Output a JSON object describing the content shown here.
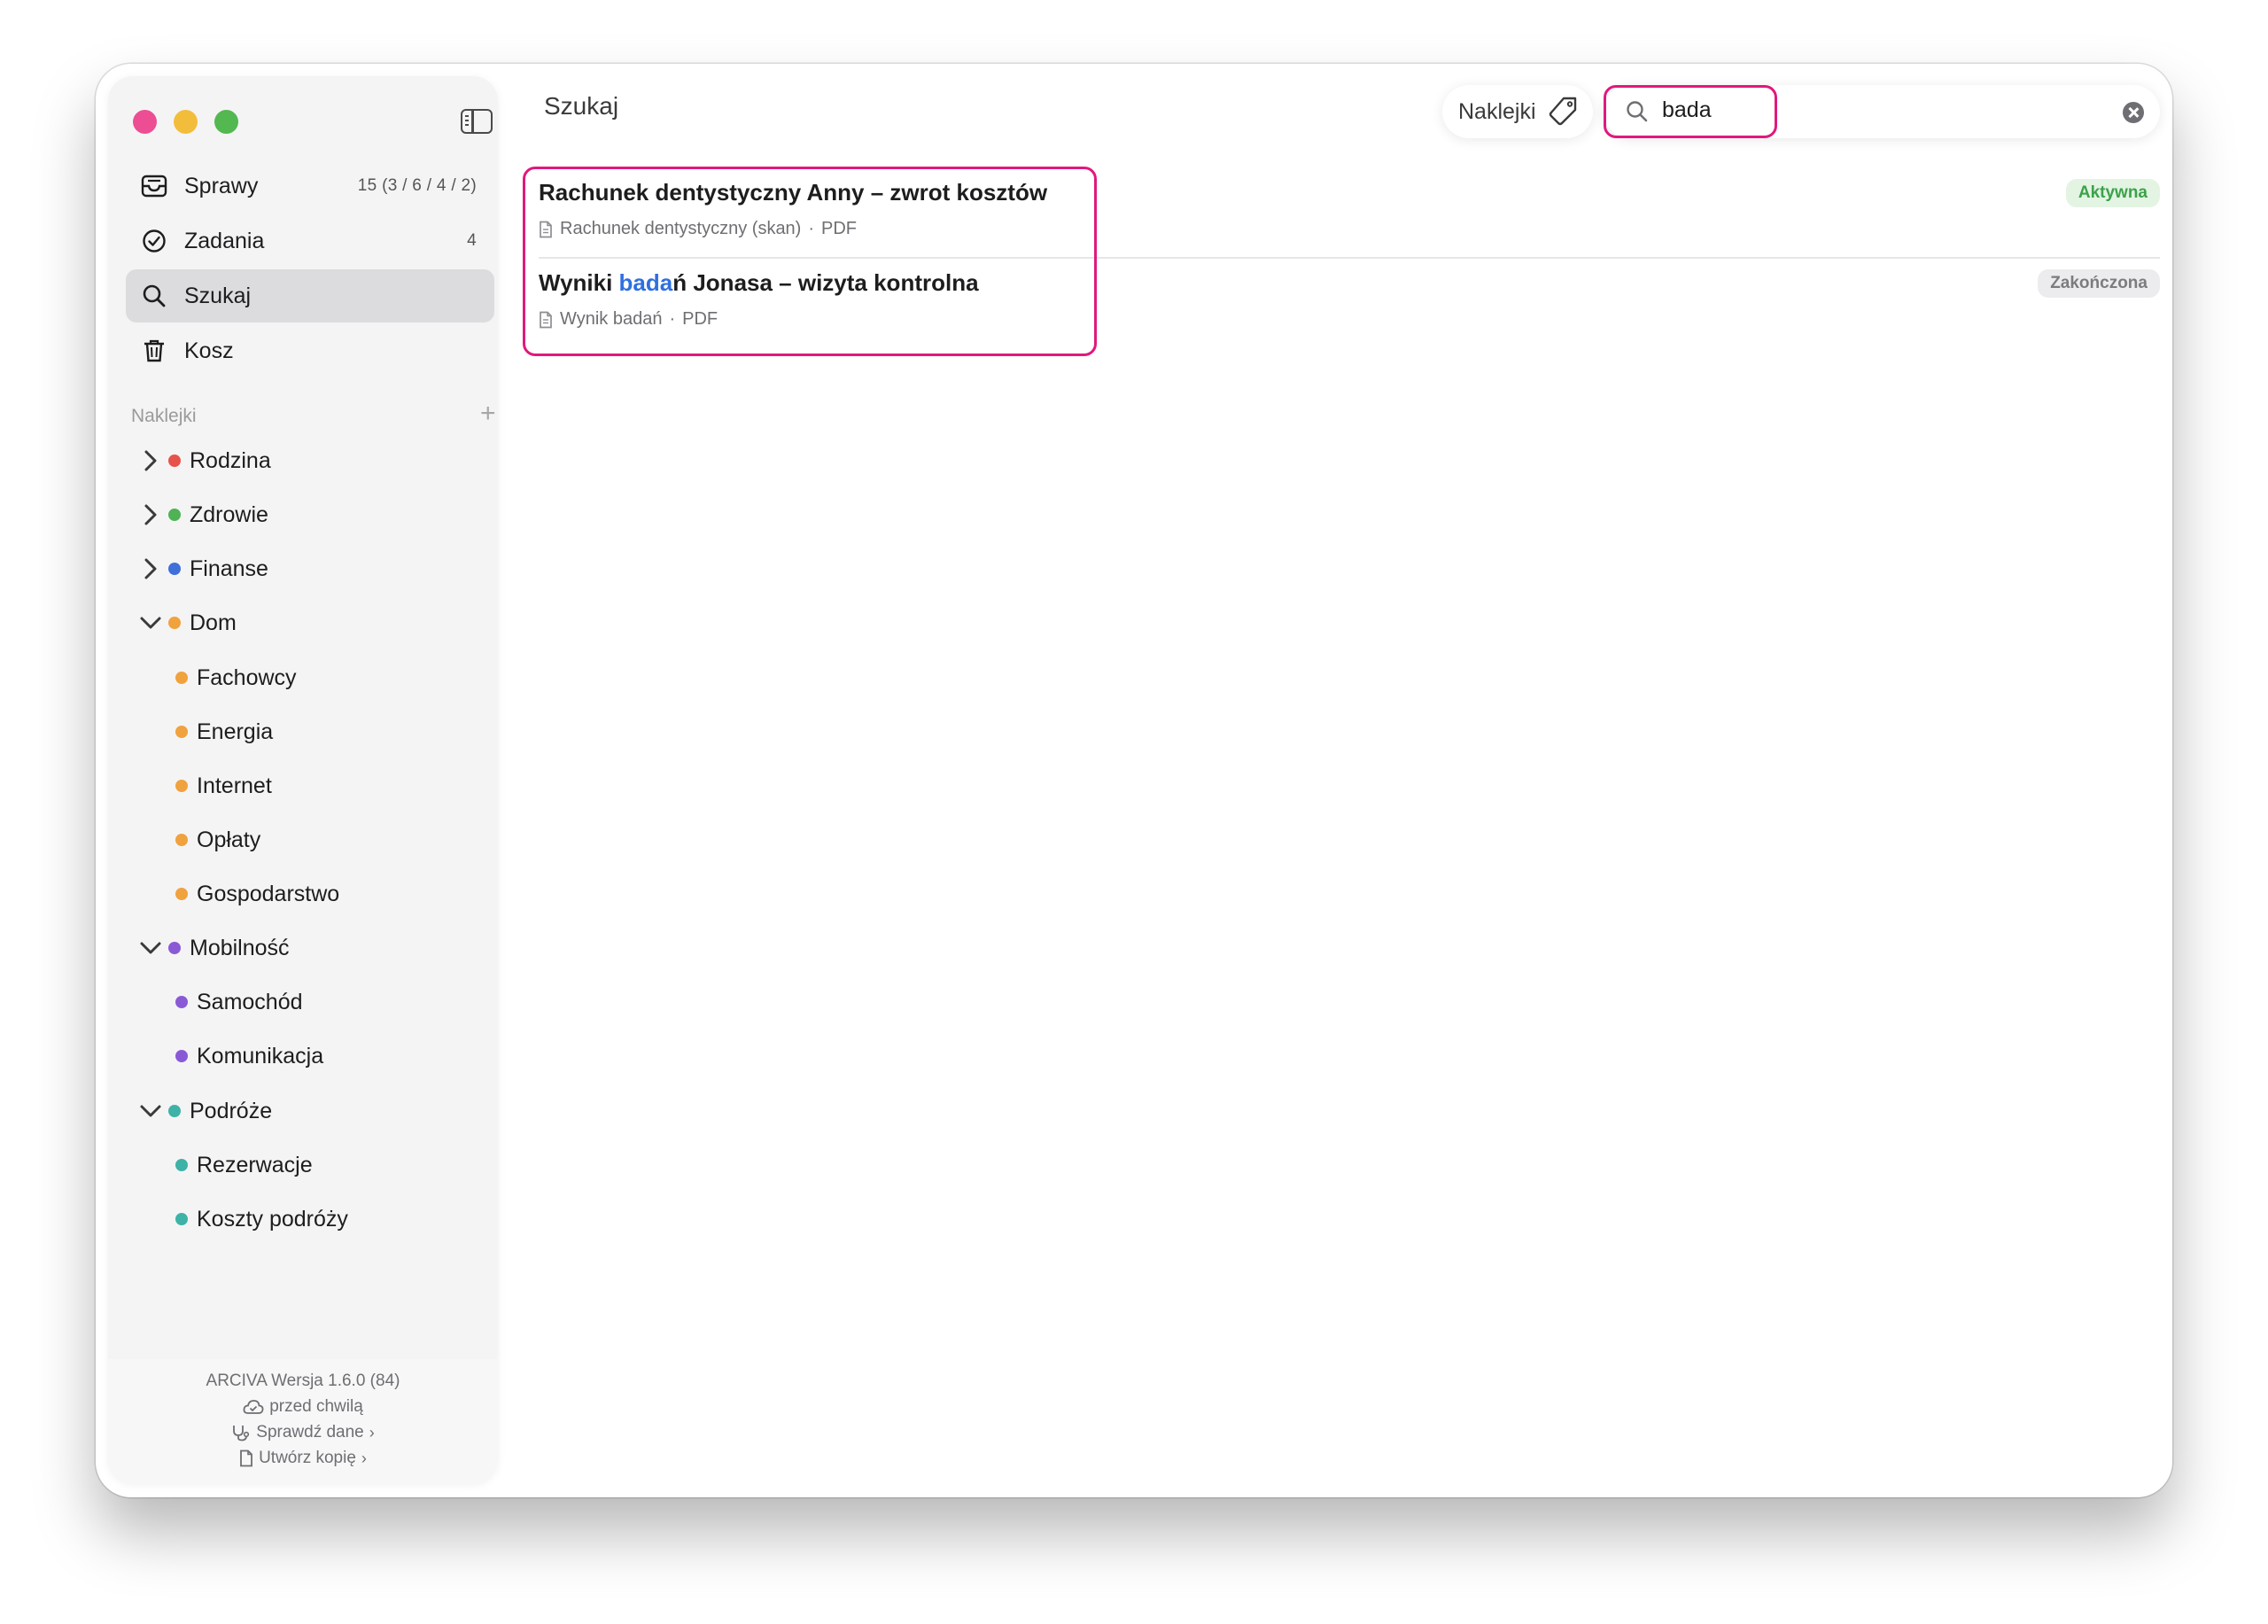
{
  "sidebar": {
    "nav": [
      {
        "label": "Sprawy",
        "count": "15  (3 / 6 / 4 / 2)",
        "icon": "inbox-icon"
      },
      {
        "label": "Zadania",
        "count": "4",
        "icon": "checkmark-circle-icon"
      },
      {
        "label": "Szukaj",
        "count": "",
        "icon": "search-icon",
        "active": true
      },
      {
        "label": "Kosz",
        "count": "",
        "icon": "trash-icon"
      }
    ],
    "tags_header": "Naklejki",
    "tags": [
      {
        "label": "Rodzina",
        "color": "#e5534b",
        "state": "collapsed"
      },
      {
        "label": "Zdrowie",
        "color": "#4fb255",
        "state": "collapsed"
      },
      {
        "label": "Finanse",
        "color": "#3f6fd8",
        "state": "collapsed"
      },
      {
        "label": "Dom",
        "color": "#f0a23e",
        "state": "expanded"
      },
      {
        "label": "Fachowcy",
        "color": "#f0a23e"
      },
      {
        "label": "Energia",
        "color": "#f0a23e"
      },
      {
        "label": "Internet",
        "color": "#f0a23e"
      },
      {
        "label": "Opłaty",
        "color": "#f0a23e"
      },
      {
        "label": "Gospodarstwo",
        "color": "#f0a23e"
      },
      {
        "label": "Mobilność",
        "color": "#8a5ad6",
        "state": "expanded"
      },
      {
        "label": "Samochód",
        "color": "#8a5ad6"
      },
      {
        "label": "Komunikacja",
        "color": "#8a5ad6"
      },
      {
        "label": "Podróże",
        "color": "#3eb2a6",
        "state": "expanded"
      },
      {
        "label": "Rezerwacje",
        "color": "#3eb2a6"
      },
      {
        "label": "Koszty podróży",
        "color": "#3eb2a6"
      }
    ],
    "footer": {
      "version": "ARCIVA  Wersja 1.6.0 (84)",
      "sync": "przed chwilą",
      "check": "Sprawdź dane",
      "backup": "Utwórz kopię"
    }
  },
  "main": {
    "title": "Szukaj",
    "tag_filter_label": "Naklejki",
    "search_value": "bada",
    "results": [
      {
        "title": "Rachunek dentystyczny Anny – zwrot kosztów",
        "document": "Rachunek dentystyczny (skan)",
        "type": "PDF",
        "status": "Aktywna"
      },
      {
        "title_before": "Wyniki ",
        "title_match": "bada",
        "title_after": "ń Jonasa – wizyta kontrolna",
        "document": "Wynik badań",
        "type": "PDF",
        "status": "Zakończona"
      }
    ]
  },
  "colors": {
    "accent_highlight": "#e0197d",
    "match_highlight": "#2f6fe0",
    "status_active": "#3ca24a"
  }
}
